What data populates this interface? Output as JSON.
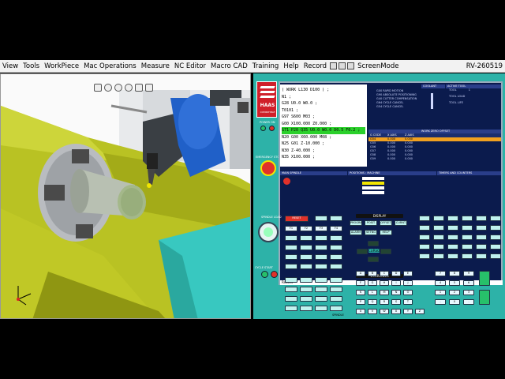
{
  "menubar": {
    "items": [
      "View",
      "Tools",
      "WorkPiece",
      "Mac Operations",
      "Measure",
      "NC Editor",
      "Macro CAD",
      "Training",
      "Help",
      "Record"
    ],
    "screenmode_label": "ScreenMode",
    "version": "RV-260519"
  },
  "controller": {
    "logo_text": "HAAS",
    "logo_sub": "COMPATIBLE",
    "program_lines": [
      "( WORK L130 D100 ) ;",
      "N1 ;",
      "G28 U0.0 W0.0 ;",
      "T0101 ;",
      "G97 S600 M03 ;",
      "G00 X100.000 Z0.000 ;",
      "G71 P20 Q35 U0.0 W0.0 D0.5 F0.2 ;",
      "N20 G00 X60.000  M08 ;",
      "N25 G01 Z-10.000 ;",
      "N30 Z-40.000 ;",
      "N35 X100.000 ;"
    ],
    "highlight_line": 6,
    "input_value": "Record",
    "active_codes": [
      "G00 RAPID MOTION",
      "G90 ABSOLUTE POSITIONING",
      "G40 CUTTER COMPENSATION",
      "G64 CYCLE CANCEL",
      "G54 CYCLE CANCEL"
    ],
    "coolant_label": "COOLANT",
    "active_tool_label": "ACTIVE TOOL",
    "tool_label": "TOOL",
    "tool_value": "1",
    "tool_load_label": "TOOL LOAD",
    "tool_life_label": "TOOL LIFE",
    "work_offset_title": "WORK ZERO OFFSET",
    "offset_headers": [
      "G CODE",
      "X AXIS",
      "Z AXIS"
    ],
    "offset_rows": [
      {
        "code": "G54",
        "x": "0.000",
        "z": "0.000"
      },
      {
        "code": "G55",
        "x": "0.000",
        "z": "0.000"
      },
      {
        "code": "G56",
        "x": "0.000",
        "z": "0.000"
      },
      {
        "code": "G57",
        "x": "0.000",
        "z": "0.000"
      },
      {
        "code": "G58",
        "x": "0.000",
        "z": "0.000"
      },
      {
        "code": "G59",
        "x": "0.000",
        "z": "0.000"
      }
    ],
    "main_spindle_title": "MAIN SPINDLE",
    "positions_title": "POSITIONS : MACHINE",
    "timers_title": "TIMERS AND COUNTERS",
    "emergency_label": "EMERGENCY STOP",
    "overrides_label": "OVERRIDES",
    "display_label": "DISPLAY",
    "cursor_label": "CURSOR",
    "spindle_label": "SPINDLE",
    "reset_label": "RESET",
    "power_on_label": "POWER ON",
    "power_off_label": "POWER OFF",
    "spindle_load_label": "SPINDLE LOAD",
    "cycle_start_label": "CYCLE START",
    "feed_hold_label": "FEED HOLD",
    "function_keys": [
      "F1",
      "F2",
      "F3",
      "F4"
    ],
    "display_keys": [
      "PROGRAM CONVRS",
      "POSIT",
      "OFFSET",
      "CURNT COMDS",
      "ALARM MESGS",
      "SETNG GRAPH",
      "HELP CALC"
    ],
    "letter_keys": [
      "A",
      "B",
      "C",
      "D",
      "E",
      "F",
      "G",
      "H",
      "I",
      "J",
      "K",
      "L",
      "M",
      "N",
      "O",
      "P",
      "Q",
      "R",
      "S",
      "T",
      "U",
      "V",
      "W",
      "X",
      "Y",
      "Z"
    ],
    "number_keys": [
      "7",
      "8",
      "9",
      "4",
      "5",
      "6",
      "1",
      "2",
      "3",
      "-",
      "0",
      "."
    ]
  },
  "viewport": {
    "toolbar_icons": [
      "home-view-icon",
      "zoom-in-icon",
      "zoom-out-icon",
      "zoom-fit-icon",
      "rotate-icon",
      "pan-icon"
    ]
  }
}
